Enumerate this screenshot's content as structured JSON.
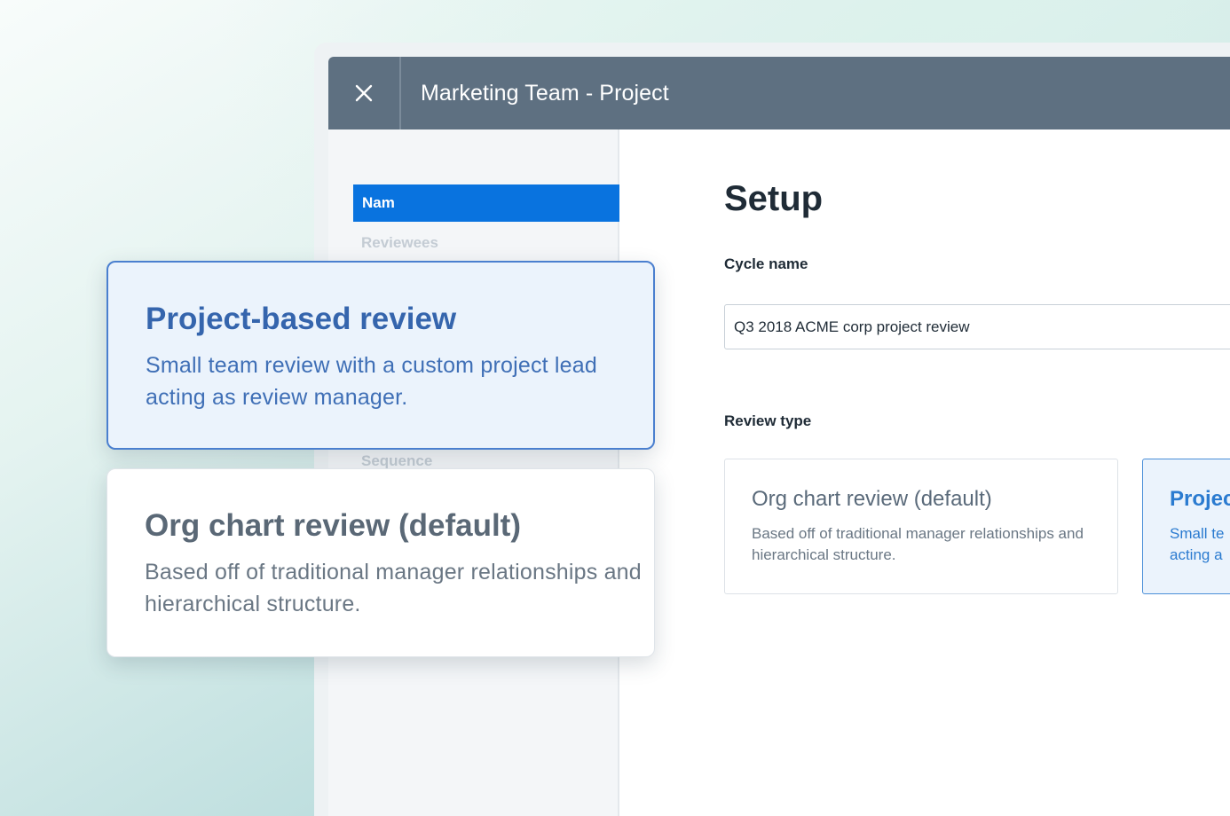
{
  "window": {
    "title": "Marketing Team - Project",
    "close_icon": "close-icon"
  },
  "sidebar": {
    "items": [
      {
        "label": "Nam",
        "active": true
      },
      {
        "label": "Reviewees",
        "active": false
      },
      {
        "label": "Sequence",
        "active": false
      }
    ]
  },
  "main": {
    "title": "Setup",
    "cycle_name": {
      "label": "Cycle name",
      "value": "Q3 2018 ACME corp project review"
    },
    "review_type": {
      "label": "Review type",
      "options": [
        {
          "title": "Org chart review (default)",
          "description": "Based off of traditional manager relationships and hierarchical structure.",
          "selected": false
        },
        {
          "title": "Projec",
          "description": "Small te acting a",
          "selected": true
        }
      ]
    }
  },
  "overlay_cards": [
    {
      "title": "Project-based review",
      "description": "Small team review with a custom project lead acting as review manager.",
      "selected": true
    },
    {
      "title": "Org chart review (default)",
      "description": "Based off of traditional manager relationships and hierarchical structure.",
      "selected": false
    }
  ],
  "colors": {
    "titlebar": "#5e7081",
    "accent": "#0973df",
    "selected_border": "#4a7fcf",
    "selected_bg": "#ebf3fc"
  }
}
